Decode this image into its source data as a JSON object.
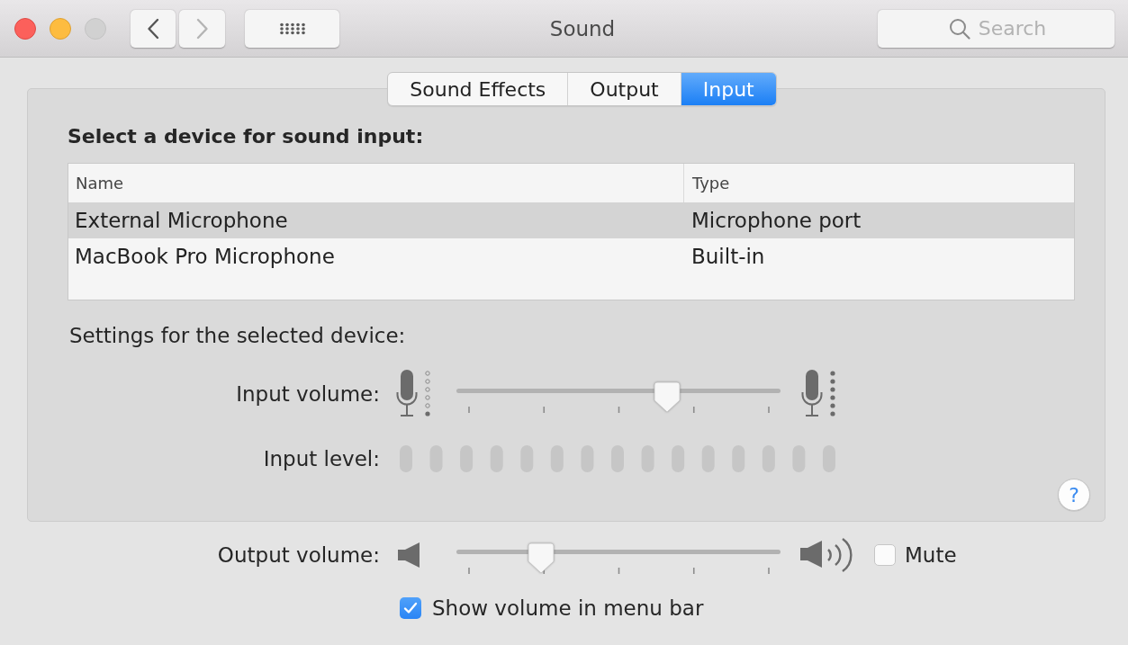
{
  "window": {
    "title": "Sound",
    "buttons": [
      {
        "kind": "close",
        "disabled": false
      },
      {
        "kind": "minimize",
        "disabled": false
      },
      {
        "kind": "zoom",
        "disabled": true
      }
    ]
  },
  "toolbar": {
    "nav_buttons": [
      {
        "kind": "back",
        "disabled": false
      },
      {
        "kind": "forward",
        "disabled": true
      }
    ],
    "search": {
      "placeholder": "Search"
    }
  },
  "tabs": [
    {
      "label": "Sound Effects",
      "selected": false
    },
    {
      "label": "Output",
      "selected": false
    },
    {
      "label": "Input",
      "selected": true
    }
  ],
  "device_section": {
    "heading": "Select a device for sound input:",
    "table": {
      "columns": [
        "Name",
        "Type"
      ],
      "rows": [
        {
          "cells": [
            "External Microphone",
            "Microphone port"
          ],
          "selected": true
        },
        {
          "cells": [
            "MacBook Pro Microphone",
            "Built-in"
          ],
          "selected": false
        }
      ]
    }
  },
  "settings": {
    "heading": "Settings for the selected device:",
    "input_volume": {
      "label": "Input volume:",
      "level": 0.65
    },
    "input_level": {
      "label": "Input level:"
    }
  },
  "help": {
    "label": "?"
  },
  "output_volume": {
    "label": "Output volume:",
    "level": 0.26
  },
  "mute": {
    "label": "Mute",
    "checked": false
  },
  "show_in_menu_bar": {
    "label": "Show volume in menu bar",
    "checked": true
  }
}
